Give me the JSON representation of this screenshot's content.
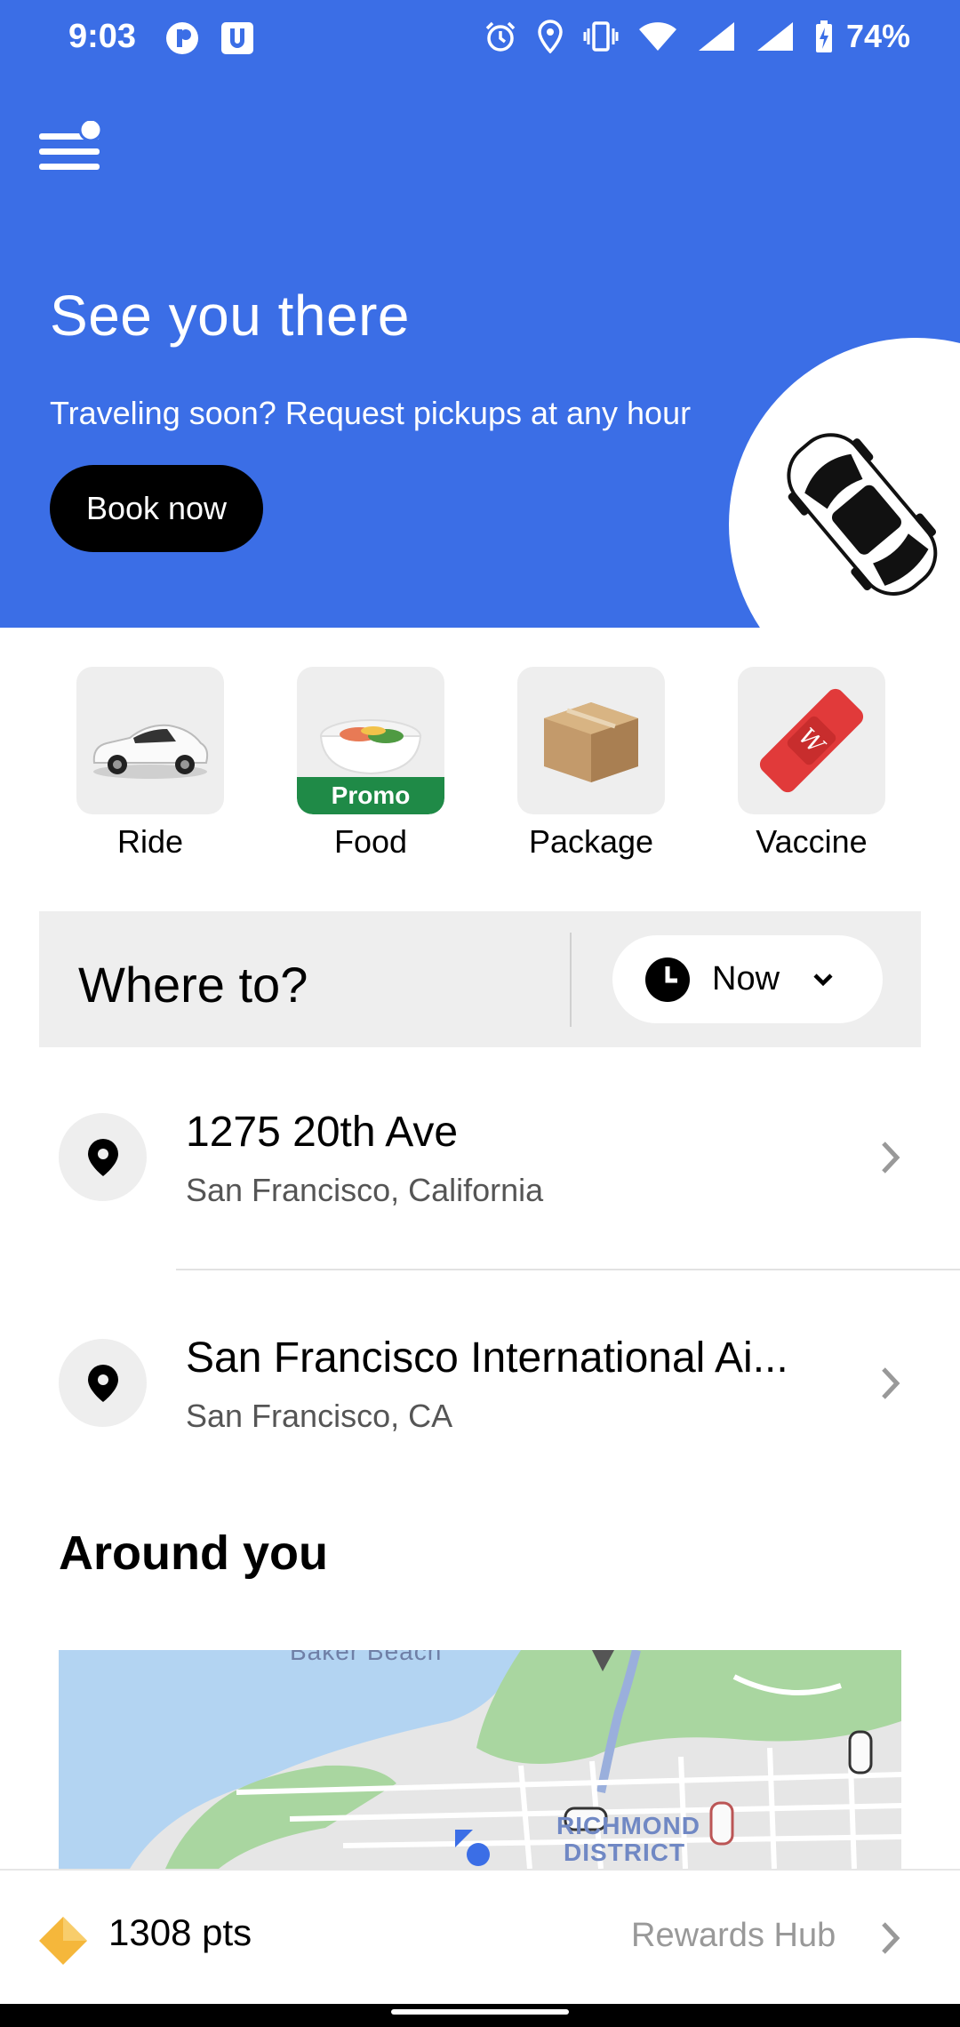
{
  "status_bar": {
    "time": "9:03",
    "battery": "74%",
    "icons": [
      "app-r-icon",
      "app-u-icon",
      "alarm-icon",
      "location-icon",
      "vibrate-icon",
      "wifi-icon",
      "signal-icon",
      "battery-icon"
    ]
  },
  "hero": {
    "title": "See you there",
    "subtitle": "Traveling soon? Request pickups at any hour",
    "button_label": "Book now",
    "background_color": "#3b6ee6"
  },
  "services": [
    {
      "label": "Ride",
      "icon": "car-icon"
    },
    {
      "label": "Food",
      "icon": "food-bowl-icon",
      "badge": "Promo"
    },
    {
      "label": "Package",
      "icon": "package-box-icon"
    },
    {
      "label": "Vaccine",
      "icon": "bandage-icon"
    }
  ],
  "where_to": {
    "label": "Where to?",
    "time_selector": "Now"
  },
  "saved_places": [
    {
      "title": "1275 20th Ave",
      "subtitle": "San Francisco, California"
    },
    {
      "title": "San Francisco International Ai...",
      "subtitle": "San Francisco, CA"
    }
  ],
  "around_you": {
    "title": "Around you",
    "map_labels": [
      "Baker Beach",
      "RICHMOND",
      "DISTRICT"
    ]
  },
  "rewards": {
    "points": "1308 pts",
    "link_label": "Rewards Hub",
    "accent_color": "#f5b73b"
  }
}
